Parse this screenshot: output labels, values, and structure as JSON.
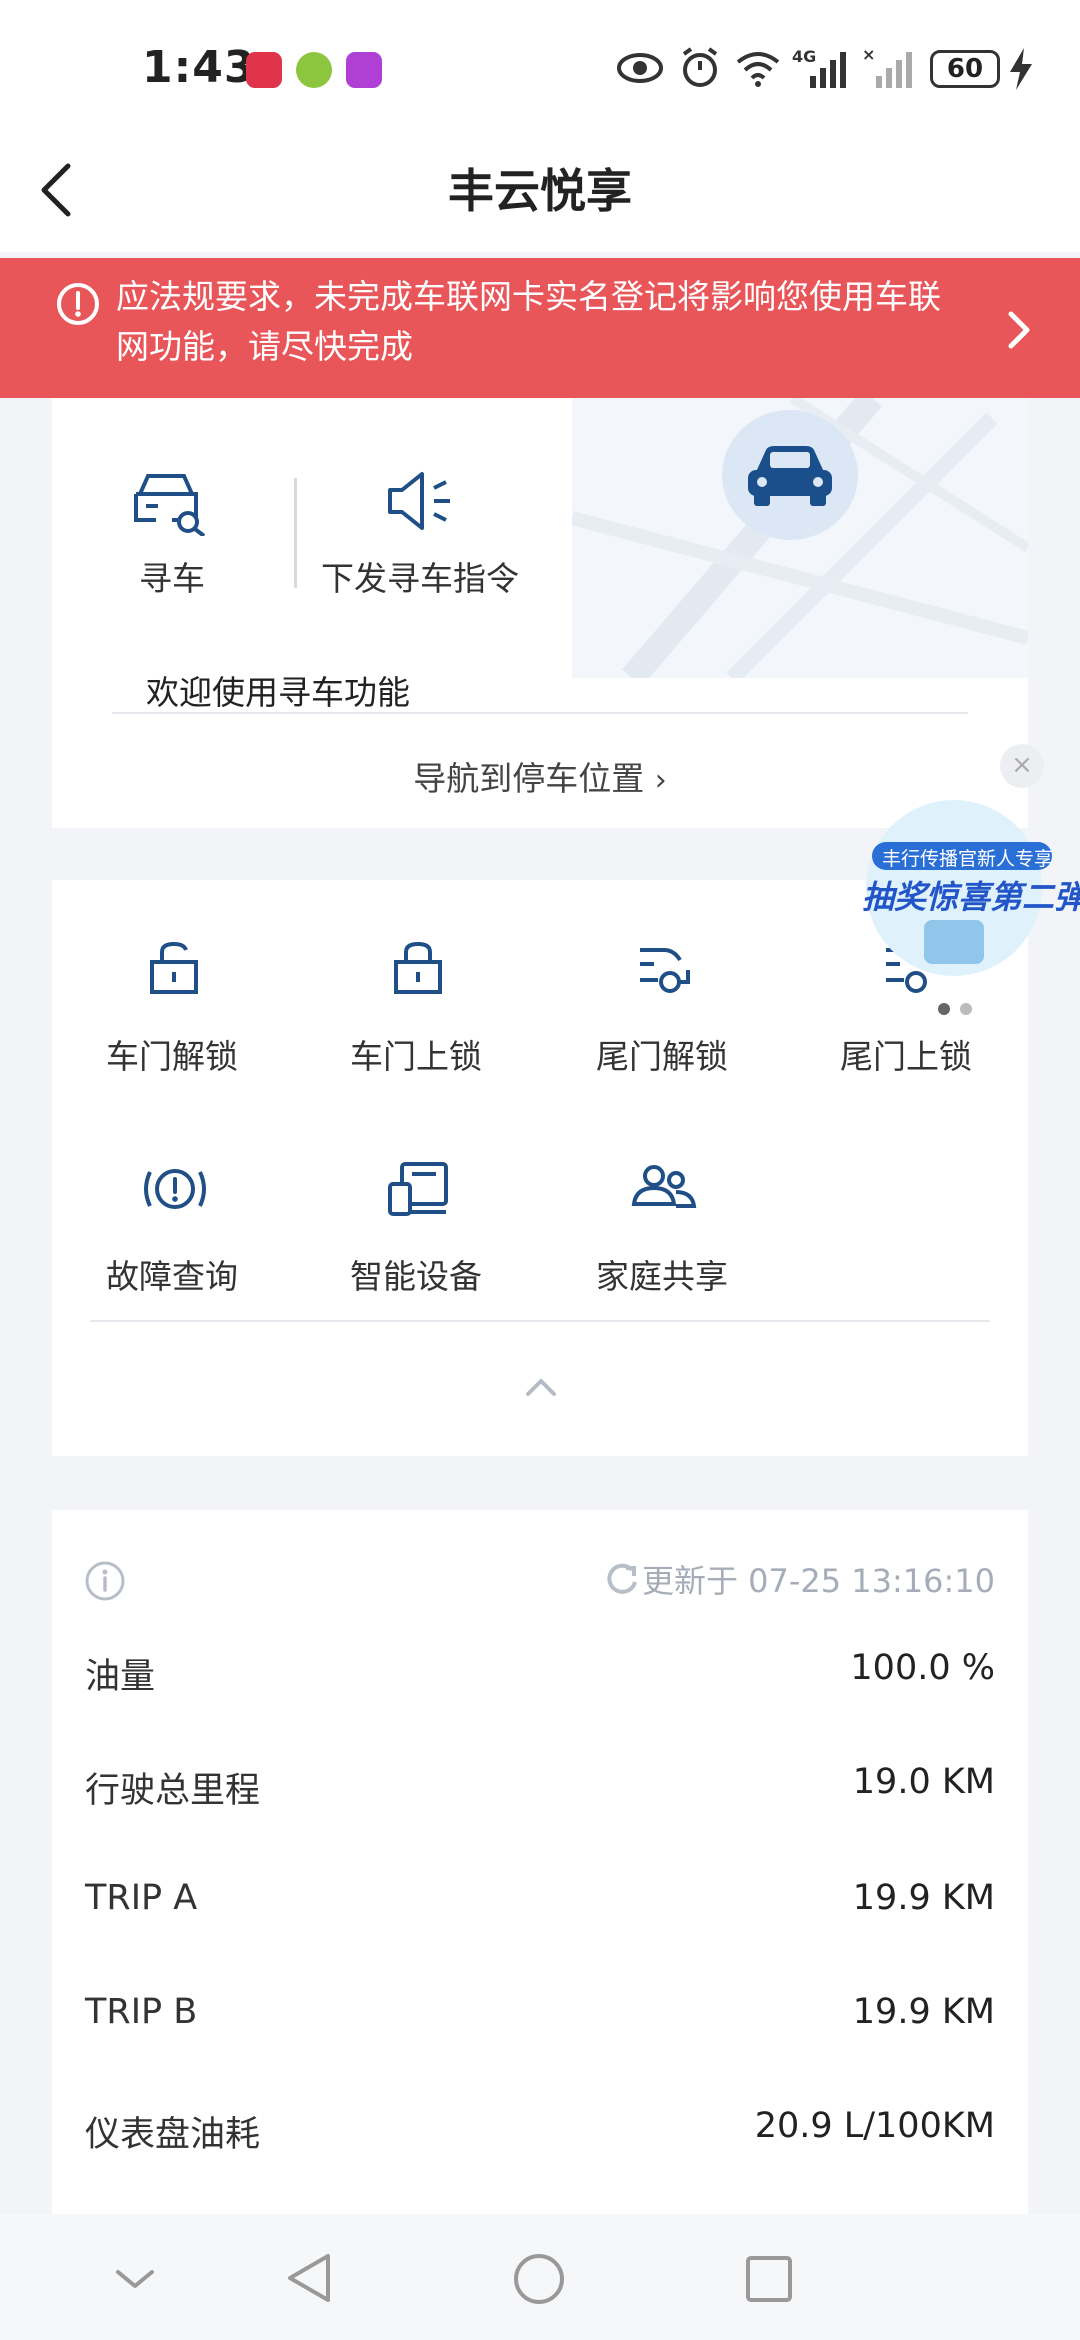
{
  "status_bar": {
    "time": "1:43",
    "battery": "60",
    "icons": [
      "eye-icon",
      "alarm-icon",
      "wifi-icon",
      "signal-4g-icon",
      "signal-icon",
      "battery-icon",
      "charging-icon"
    ]
  },
  "header": {
    "title": "丰云悦享",
    "back_icon": "chevron-left-icon"
  },
  "alert": {
    "text": "应法规要求，未完成车联网卡实名登记将影响您使用车联网功能，请尽快完成",
    "bg_color": "#e9565a"
  },
  "find_car": {
    "find_label": "寻车",
    "command_label": "下发寻车指令",
    "welcome": "欢迎使用寻车功能",
    "navigate": "导航到停车位置"
  },
  "promo": {
    "line1": "丰行传播官新人专享",
    "line2": "抽奖惊喜第二弹"
  },
  "functions": [
    {
      "label": "车门解锁",
      "icon": "unlock-icon"
    },
    {
      "label": "车门上锁",
      "icon": "lock-icon"
    },
    {
      "label": "尾门解锁",
      "icon": "trunk-unlock-icon"
    },
    {
      "label": "尾门上锁",
      "icon": "trunk-lock-icon"
    },
    {
      "label": "故障查询",
      "icon": "fault-icon"
    },
    {
      "label": "智能设备",
      "icon": "smart-device-icon"
    },
    {
      "label": "家庭共享",
      "icon": "family-share-icon"
    }
  ],
  "vehicle": {
    "updated": "更新于 07-25 13:16:10",
    "rows": [
      {
        "label": "油量",
        "value": "100.0 %"
      },
      {
        "label": "行驶总里程",
        "value": "19.0 KM"
      },
      {
        "label": "TRIP A",
        "value": "19.9 KM"
      },
      {
        "label": "TRIP B",
        "value": "19.9 KM"
      },
      {
        "label": "仪表盘油耗",
        "value": "20.9 L/100KM"
      }
    ]
  },
  "colors": {
    "accent": "#1f5a96",
    "icon_blue": "#1f4f86"
  }
}
